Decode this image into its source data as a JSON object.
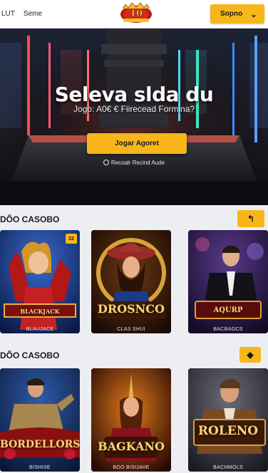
{
  "header": {
    "nav": [
      "LUT",
      "Seme"
    ],
    "logo_text": "10",
    "cta_label": "Sopno",
    "cta_icon": "chevron-down-icon"
  },
  "hero": {
    "title": "Seleva slda du",
    "subtitle": "Jogo: A0€ € Fiirecead Formina?",
    "button_label": "Jogar Agoret",
    "link_label": "Recoalr Recind Aude"
  },
  "sections": [
    {
      "title": "DÕO CASOBO",
      "arrow": "↰",
      "cards": [
        {
          "brand": "BLACKJACK",
          "caption": "BLAUJACE",
          "badge": "22"
        },
        {
          "brand": "DROSNCO",
          "caption": "CLAS SHUI"
        },
        {
          "brand": "AQURP",
          "caption": "BACBAGCS"
        }
      ]
    },
    {
      "title": "DÕO CASOBO",
      "arrow": "◆",
      "cards": [
        {
          "brand": "BORDELLORS",
          "caption": "BISHISE"
        },
        {
          "brand": "BAGKANO",
          "caption": "BOO BISIJAVE"
        },
        {
          "brand": "ROLENO",
          "caption": "BACHMOLS"
        }
      ]
    }
  ],
  "colors": {
    "accent": "#f7b71a",
    "background": "#eceef2",
    "header_bg": "#ffffff"
  }
}
